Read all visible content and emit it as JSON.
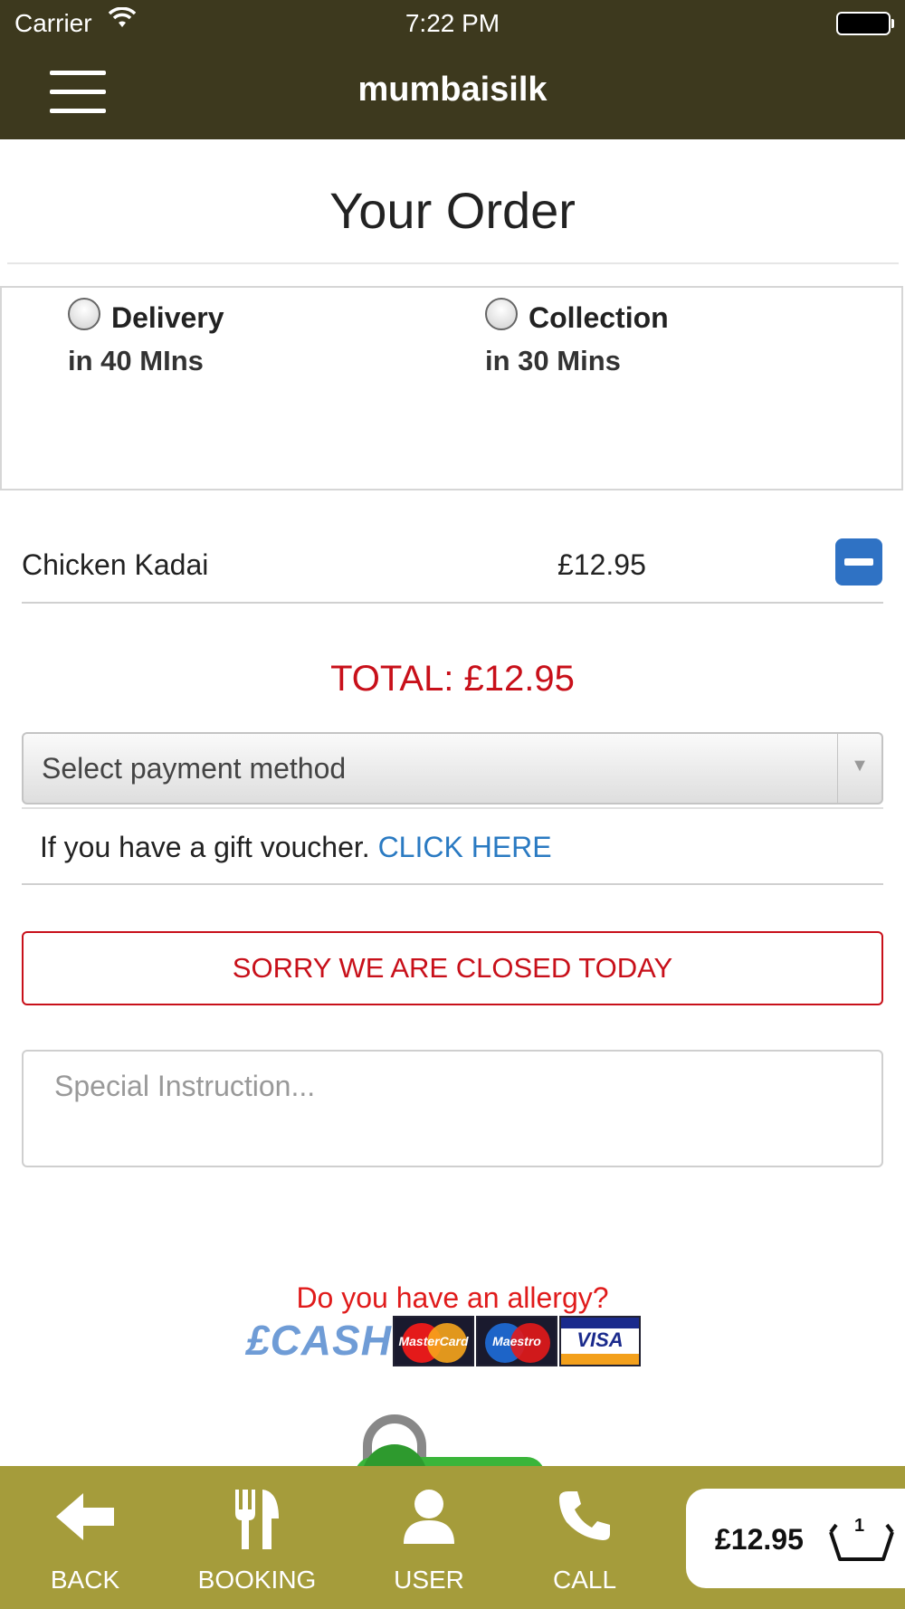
{
  "status_bar": {
    "carrier": "Carrier",
    "time": "7:22 PM"
  },
  "navbar": {
    "title": "mumbaisilk",
    "menu_icon": "hamburger-menu-icon"
  },
  "page": {
    "title": "Your Order"
  },
  "fulfilment": {
    "options": [
      {
        "label": "Delivery",
        "sub": "in 40 MIns",
        "selected": false
      },
      {
        "label": "Collection",
        "sub": "in 30 Mins",
        "selected": false
      }
    ]
  },
  "order": {
    "items": [
      {
        "name": "Chicken Kadai",
        "price": "£12.95"
      }
    ],
    "total": "TOTAL: £12.95"
  },
  "payment": {
    "placeholder": "Select payment method"
  },
  "voucher": {
    "text": "If you have a gift voucher.",
    "link": "CLICK HERE"
  },
  "notice": {
    "closed": "SORRY WE ARE CLOSED TODAY"
  },
  "instructions": {
    "placeholder": "Special Instruction..."
  },
  "allergy": {
    "text": "Do you have an allergy?"
  },
  "payment_logos": {
    "cash": "£CASH",
    "cards": [
      "MasterCard",
      "Maestro",
      "VISA"
    ]
  },
  "bottom_nav": [
    {
      "label": "BACK",
      "icon": "back-arrow-icon"
    },
    {
      "label": "BOOKING",
      "icon": "fork-knife-icon"
    },
    {
      "label": "USER",
      "icon": "user-icon"
    },
    {
      "label": "CALL",
      "icon": "phone-icon"
    }
  ],
  "cart": {
    "total": "£12.95",
    "count": "1",
    "icon": "basket-icon"
  },
  "colors": {
    "header": "#3d391e",
    "bottom_bar": "#a59c3b",
    "alert_red": "#c8101a",
    "link_blue": "#2a7ac2",
    "button_blue": "#2f72c4"
  }
}
